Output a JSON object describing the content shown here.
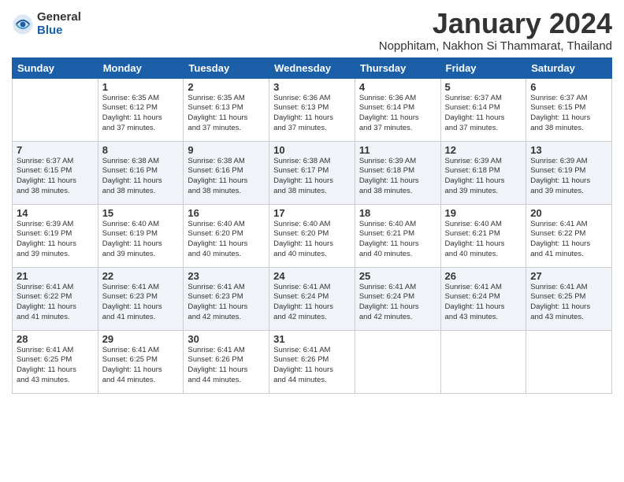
{
  "logo": {
    "general": "General",
    "blue": "Blue"
  },
  "title": "January 2024",
  "location": "Nopphitam, Nakhon Si Thammarat, Thailand",
  "days_of_week": [
    "Sunday",
    "Monday",
    "Tuesday",
    "Wednesday",
    "Thursday",
    "Friday",
    "Saturday"
  ],
  "weeks": [
    [
      {
        "day": "",
        "info": ""
      },
      {
        "day": "1",
        "info": "Sunrise: 6:35 AM\nSunset: 6:12 PM\nDaylight: 11 hours\nand 37 minutes."
      },
      {
        "day": "2",
        "info": "Sunrise: 6:35 AM\nSunset: 6:13 PM\nDaylight: 11 hours\nand 37 minutes."
      },
      {
        "day": "3",
        "info": "Sunrise: 6:36 AM\nSunset: 6:13 PM\nDaylight: 11 hours\nand 37 minutes."
      },
      {
        "day": "4",
        "info": "Sunrise: 6:36 AM\nSunset: 6:14 PM\nDaylight: 11 hours\nand 37 minutes."
      },
      {
        "day": "5",
        "info": "Sunrise: 6:37 AM\nSunset: 6:14 PM\nDaylight: 11 hours\nand 37 minutes."
      },
      {
        "day": "6",
        "info": "Sunrise: 6:37 AM\nSunset: 6:15 PM\nDaylight: 11 hours\nand 38 minutes."
      }
    ],
    [
      {
        "day": "7",
        "info": "Sunrise: 6:37 AM\nSunset: 6:15 PM\nDaylight: 11 hours\nand 38 minutes."
      },
      {
        "day": "8",
        "info": "Sunrise: 6:38 AM\nSunset: 6:16 PM\nDaylight: 11 hours\nand 38 minutes."
      },
      {
        "day": "9",
        "info": "Sunrise: 6:38 AM\nSunset: 6:16 PM\nDaylight: 11 hours\nand 38 minutes."
      },
      {
        "day": "10",
        "info": "Sunrise: 6:38 AM\nSunset: 6:17 PM\nDaylight: 11 hours\nand 38 minutes."
      },
      {
        "day": "11",
        "info": "Sunrise: 6:39 AM\nSunset: 6:18 PM\nDaylight: 11 hours\nand 38 minutes."
      },
      {
        "day": "12",
        "info": "Sunrise: 6:39 AM\nSunset: 6:18 PM\nDaylight: 11 hours\nand 39 minutes."
      },
      {
        "day": "13",
        "info": "Sunrise: 6:39 AM\nSunset: 6:19 PM\nDaylight: 11 hours\nand 39 minutes."
      }
    ],
    [
      {
        "day": "14",
        "info": "Sunrise: 6:39 AM\nSunset: 6:19 PM\nDaylight: 11 hours\nand 39 minutes."
      },
      {
        "day": "15",
        "info": "Sunrise: 6:40 AM\nSunset: 6:19 PM\nDaylight: 11 hours\nand 39 minutes."
      },
      {
        "day": "16",
        "info": "Sunrise: 6:40 AM\nSunset: 6:20 PM\nDaylight: 11 hours\nand 40 minutes."
      },
      {
        "day": "17",
        "info": "Sunrise: 6:40 AM\nSunset: 6:20 PM\nDaylight: 11 hours\nand 40 minutes."
      },
      {
        "day": "18",
        "info": "Sunrise: 6:40 AM\nSunset: 6:21 PM\nDaylight: 11 hours\nand 40 minutes."
      },
      {
        "day": "19",
        "info": "Sunrise: 6:40 AM\nSunset: 6:21 PM\nDaylight: 11 hours\nand 40 minutes."
      },
      {
        "day": "20",
        "info": "Sunrise: 6:41 AM\nSunset: 6:22 PM\nDaylight: 11 hours\nand 41 minutes."
      }
    ],
    [
      {
        "day": "21",
        "info": "Sunrise: 6:41 AM\nSunset: 6:22 PM\nDaylight: 11 hours\nand 41 minutes."
      },
      {
        "day": "22",
        "info": "Sunrise: 6:41 AM\nSunset: 6:23 PM\nDaylight: 11 hours\nand 41 minutes."
      },
      {
        "day": "23",
        "info": "Sunrise: 6:41 AM\nSunset: 6:23 PM\nDaylight: 11 hours\nand 42 minutes."
      },
      {
        "day": "24",
        "info": "Sunrise: 6:41 AM\nSunset: 6:24 PM\nDaylight: 11 hours\nand 42 minutes."
      },
      {
        "day": "25",
        "info": "Sunrise: 6:41 AM\nSunset: 6:24 PM\nDaylight: 11 hours\nand 42 minutes."
      },
      {
        "day": "26",
        "info": "Sunrise: 6:41 AM\nSunset: 6:24 PM\nDaylight: 11 hours\nand 43 minutes."
      },
      {
        "day": "27",
        "info": "Sunrise: 6:41 AM\nSunset: 6:25 PM\nDaylight: 11 hours\nand 43 minutes."
      }
    ],
    [
      {
        "day": "28",
        "info": "Sunrise: 6:41 AM\nSunset: 6:25 PM\nDaylight: 11 hours\nand 43 minutes."
      },
      {
        "day": "29",
        "info": "Sunrise: 6:41 AM\nSunset: 6:25 PM\nDaylight: 11 hours\nand 44 minutes."
      },
      {
        "day": "30",
        "info": "Sunrise: 6:41 AM\nSunset: 6:26 PM\nDaylight: 11 hours\nand 44 minutes."
      },
      {
        "day": "31",
        "info": "Sunrise: 6:41 AM\nSunset: 6:26 PM\nDaylight: 11 hours\nand 44 minutes."
      },
      {
        "day": "",
        "info": ""
      },
      {
        "day": "",
        "info": ""
      },
      {
        "day": "",
        "info": ""
      }
    ]
  ]
}
